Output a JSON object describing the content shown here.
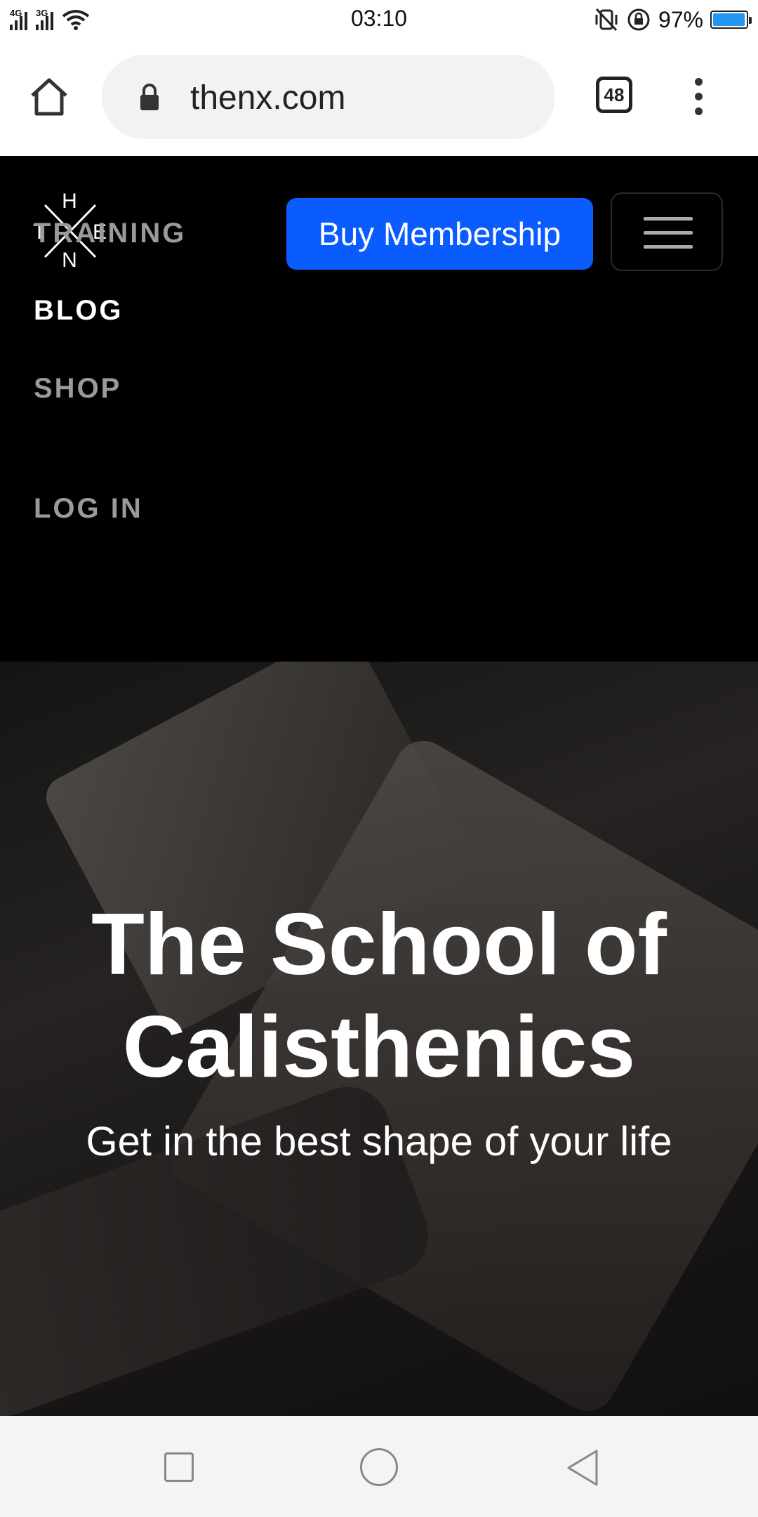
{
  "status_bar": {
    "net1": "4G",
    "net2": "3G",
    "time": "03:10",
    "battery_percent": "97%",
    "battery_level": 0.97,
    "battery_color": "#2196f3"
  },
  "browser": {
    "url": "thenx.com",
    "tab_count": "48"
  },
  "site_header": {
    "logo_letters": [
      "H",
      "T",
      "E",
      "N"
    ],
    "buy_label": "Buy Membership",
    "buy_color": "#0a5cff",
    "nav": [
      {
        "label": "TRAINING"
      },
      {
        "label": "BLOG"
      },
      {
        "label": "SHOP"
      },
      {
        "label": "LOG IN"
      }
    ],
    "active_nav": "BLOG"
  },
  "hero": {
    "title_line1": "The School of",
    "title_line2": "Calisthenics",
    "subtitle": "Get in the best shape of your life"
  }
}
